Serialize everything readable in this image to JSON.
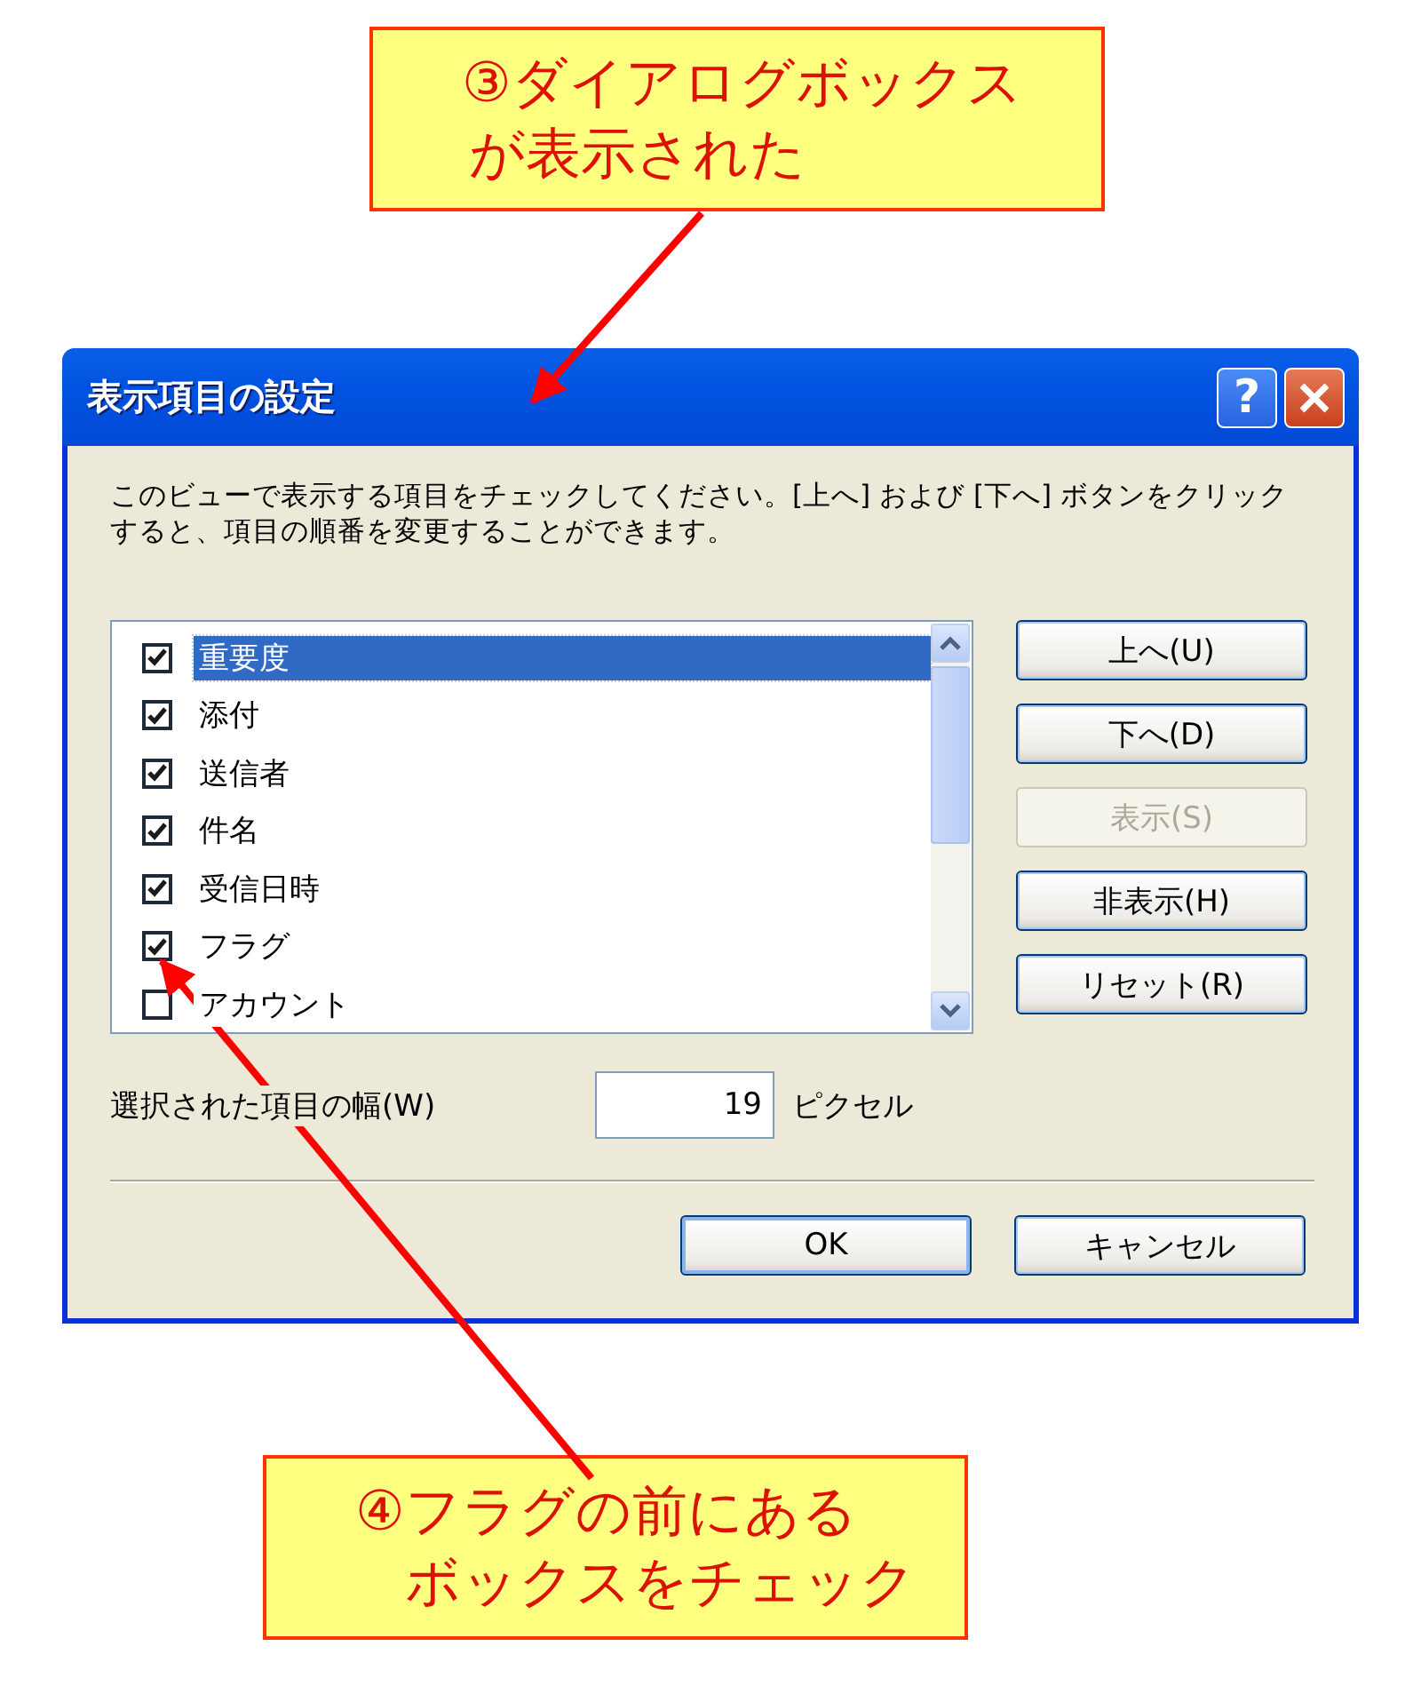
{
  "callouts": [
    {
      "lines": [
        "③ダイアログボックス",
        "が表示された"
      ]
    },
    {
      "lines": [
        "④フラグの前にある",
        "ボックスをチェック"
      ]
    }
  ],
  "dialog": {
    "title": "表示項目の設定",
    "help_button": "?",
    "description": "このビューで表示する項目をチェックしてください。[上へ] および [下へ] ボタンをクリックすると、項目の順番を変更することができます。",
    "items": [
      {
        "label": "重要度",
        "checked": true,
        "selected": true
      },
      {
        "label": "添付",
        "checked": true,
        "selected": false
      },
      {
        "label": "送信者",
        "checked": true,
        "selected": false
      },
      {
        "label": "件名",
        "checked": true,
        "selected": false
      },
      {
        "label": "受信日時",
        "checked": true,
        "selected": false
      },
      {
        "label": "フラグ",
        "checked": true,
        "selected": false
      },
      {
        "label": "アカウント",
        "checked": false,
        "selected": false
      }
    ],
    "side_buttons": [
      {
        "label": "上へ(U)",
        "disabled": false
      },
      {
        "label": "下へ(D)",
        "disabled": false
      },
      {
        "label": "表示(S)",
        "disabled": true
      },
      {
        "label": "非表示(H)",
        "disabled": false
      },
      {
        "label": "リセット(R)",
        "disabled": false
      }
    ],
    "width_label": "選択された項目の幅(W)",
    "width_value": "19",
    "width_unit": "ピクセル",
    "footer_buttons": [
      {
        "label": "OK"
      },
      {
        "label": "キャンセル"
      }
    ]
  }
}
